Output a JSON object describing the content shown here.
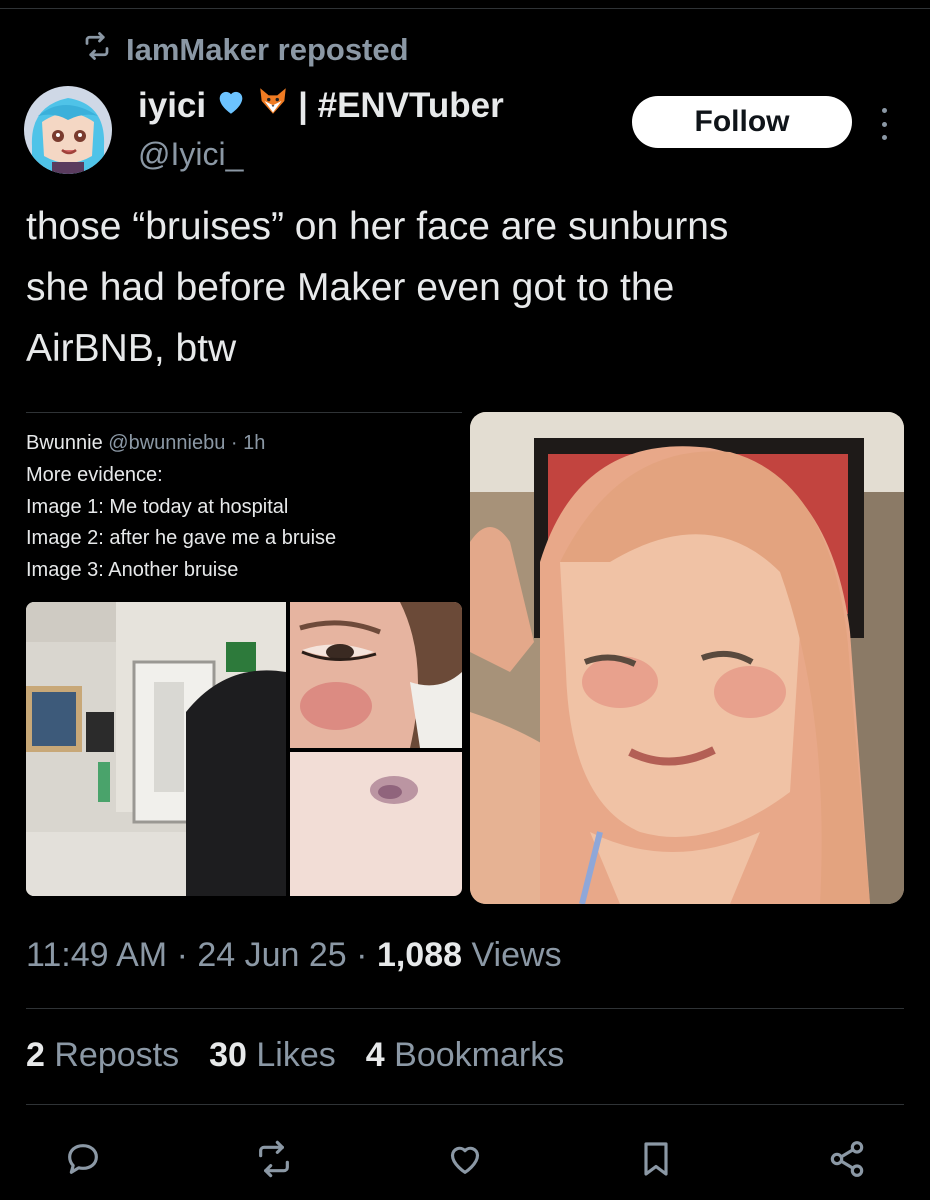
{
  "repost": {
    "text": "IamMaker reposted"
  },
  "author": {
    "name": "iyici",
    "tag": "| #ENVTuber",
    "handle": "@Iyici_"
  },
  "follow_label": "Follow",
  "tweet": {
    "text": "those “bruises” on her face are sunburns\nshe had before Maker even got to the\nAirBNB, btw"
  },
  "quoted": {
    "name": "Bwunnie",
    "handle_time": "@bwunniebu · 1h",
    "lines": [
      "More evidence:",
      "Image 1: Me today at hospital",
      "Image 2: after he gave me a bruise",
      "Image 3: Another bruise"
    ]
  },
  "meta": {
    "time": "11:49 AM",
    "date": "24 Jun 25",
    "views_count": "1,088",
    "views_label": "Views",
    "sep": " · "
  },
  "stats": {
    "reposts_count": "2",
    "reposts_label": "Reposts",
    "likes_count": "30",
    "likes_label": "Likes",
    "bookmarks_count": "4",
    "bookmarks_label": "Bookmarks"
  },
  "icons": {
    "repost": "repost-icon",
    "reply": "reply-icon",
    "retweet": "retweet-icon",
    "like": "heart-icon",
    "bookmark": "bookmark-icon",
    "share": "share-icon",
    "more": "more-vertical-icon",
    "heart_emoji": "blue-heart-emoji",
    "fox_emoji": "fox-emoji"
  },
  "colors": {
    "background": "#000000",
    "text": "#e7e9ea",
    "secondary": "#8b98a5",
    "follow_bg": "#ffffff"
  }
}
